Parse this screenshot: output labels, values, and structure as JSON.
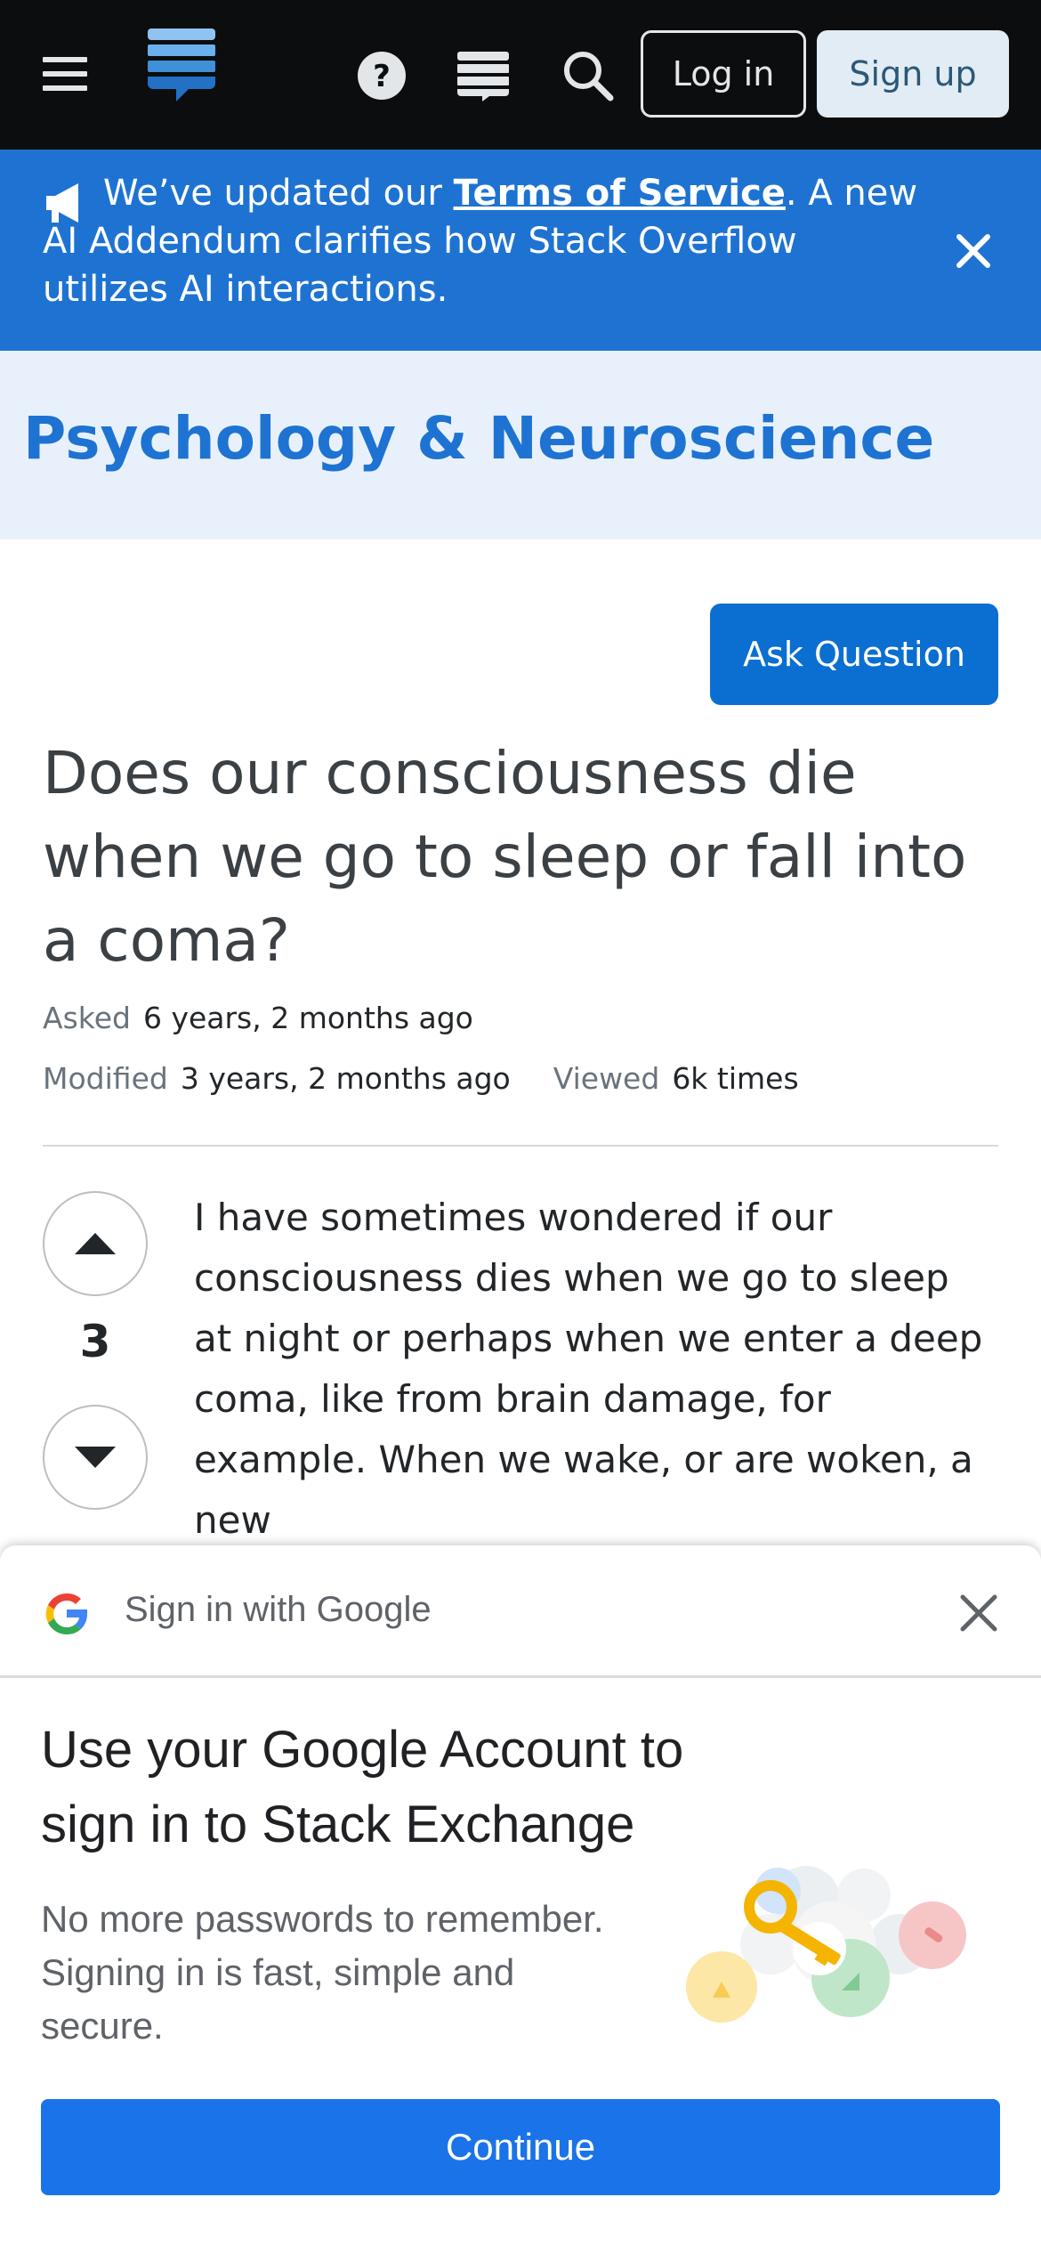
{
  "topbar": {
    "login_label": "Log in",
    "signup_label": "Sign up",
    "icons": [
      "menu-icon",
      "stack-exchange-logo",
      "help-icon",
      "chat-icon",
      "search-icon"
    ]
  },
  "notice": {
    "text_before": "We’ve updated our ",
    "link_text": "Terms of Service",
    "text_after": ". A new AI Addendum clarifies how Stack Overflow utilizes AI interactions.",
    "background": "#1e73d2"
  },
  "site": {
    "title": "Psychology & Neuroscience",
    "title_color": "#1e73d2",
    "header_background": "#e8f1fb"
  },
  "question": {
    "ask_button": "Ask Question",
    "title": "Does our consciousness die when we go to sleep or fall into a coma?",
    "asked_label": "Asked",
    "asked_value": "6 years, 2 months ago",
    "modified_label": "Modified",
    "modified_value": "3 years, 2 months ago",
    "viewed_label": "Viewed",
    "viewed_value": "6k times",
    "votes": "3",
    "body": "I have sometimes wondered if our consciousness dies when we go to sleep at night or perhaps when we enter a deep coma, like from brain damage, for example. When we wake, or are woken, a new"
  },
  "google_signin": {
    "header": "Sign in with Google",
    "title": "Use your Google Account to sign in to Stack Exchange",
    "subtitle": "No more passwords to remember. Signing in is fast, simple and secure.",
    "continue_label": "Continue",
    "button_color": "#1a73e8"
  }
}
